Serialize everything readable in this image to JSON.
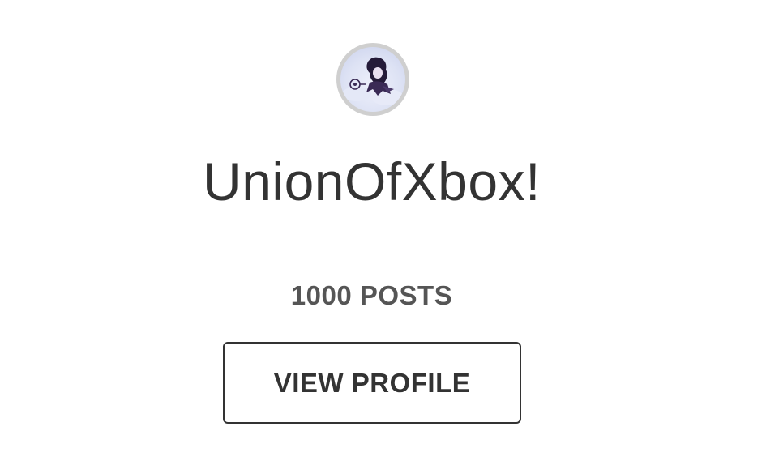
{
  "profile": {
    "username": "UnionOfXbox!",
    "posts_label": "1000 POSTS",
    "view_profile_label": "VIEW PROFILE"
  },
  "colors": {
    "text": "#333333",
    "secondary_text": "#555555",
    "avatar_border": "#cfcfcf",
    "button_border": "#333333"
  }
}
